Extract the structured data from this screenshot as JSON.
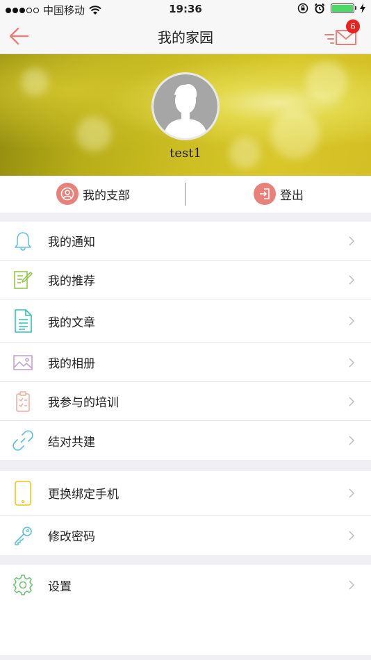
{
  "status_bar": {
    "carrier": "中国移动",
    "time": "19:36"
  },
  "nav": {
    "title": "我的家园",
    "badge_count": "6"
  },
  "profile": {
    "username": "test1"
  },
  "actions": {
    "branch_label": "我的支部",
    "logout_label": "登出"
  },
  "menu": {
    "notifications": "我的通知",
    "recommendations": "我的推荐",
    "articles": "我的文章",
    "album": "我的相册",
    "trainings": "我参与的培训",
    "pairing": "结对共建",
    "change_phone": "更换绑定手机",
    "change_password": "修改密码",
    "settings": "设置"
  },
  "colors": {
    "accent": "#e8817a",
    "badge": "#e8221e",
    "battery": "#4cd964"
  }
}
